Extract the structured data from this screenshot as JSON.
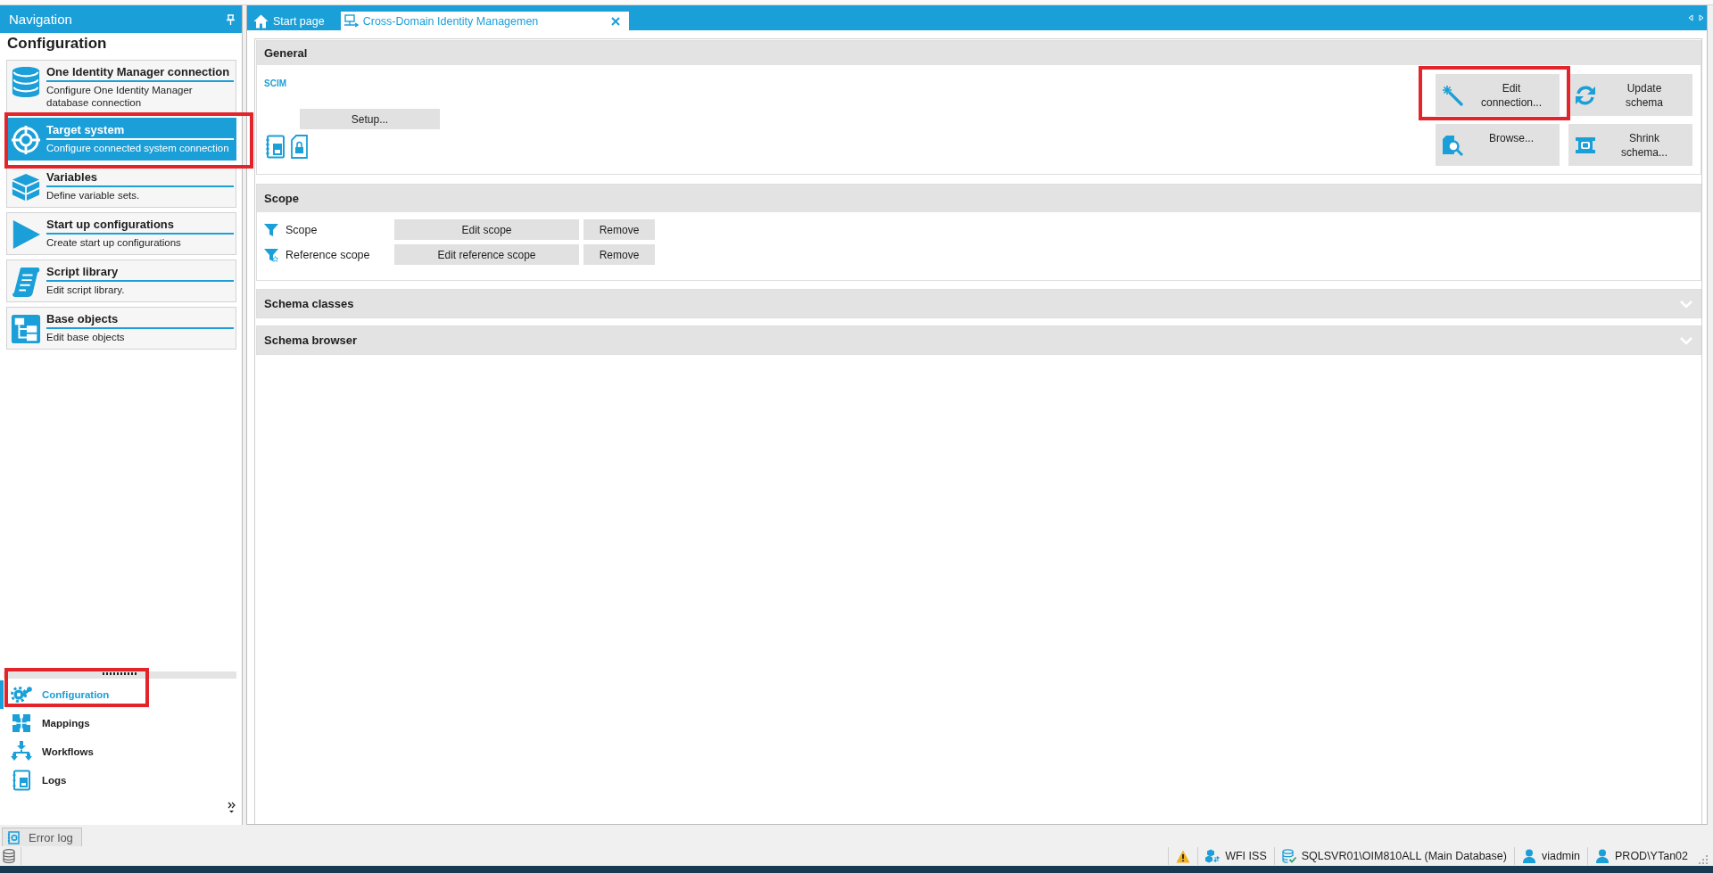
{
  "navigation": {
    "title": "Navigation",
    "heading": "Configuration",
    "items": [
      {
        "title": "One Identity Manager connection",
        "description": "Configure One Identity Manager database connection",
        "selected": false,
        "highlighted": false
      },
      {
        "title": "Target system",
        "description": "Configure connected system connection",
        "selected": true,
        "highlighted": true
      },
      {
        "title": "Variables",
        "description": "Define variable sets.",
        "selected": false,
        "highlighted": false
      },
      {
        "title": "Start up configurations",
        "description": "Create start up configurations",
        "selected": false,
        "highlighted": false
      },
      {
        "title": "Script library",
        "description": "Edit script library.",
        "selected": false,
        "highlighted": false
      },
      {
        "title": "Base objects",
        "description": "Edit base objects",
        "selected": false,
        "highlighted": false
      }
    ],
    "sections": [
      {
        "label": "Configuration",
        "selected": true,
        "highlighted": true
      },
      {
        "label": "Mappings",
        "selected": false,
        "highlighted": false
      },
      {
        "label": "Workflows",
        "selected": false,
        "highlighted": false
      },
      {
        "label": "Logs",
        "selected": false,
        "highlighted": false
      }
    ]
  },
  "tabs": [
    {
      "label": "Start page",
      "selected": false,
      "closable": false
    },
    {
      "label": "Cross-Domain Identity Managemen",
      "selected": true,
      "closable": true
    }
  ],
  "general": {
    "title": "General",
    "logo": "SCIM",
    "setup_button": "Setup...",
    "actions": [
      {
        "label": "Edit connection...",
        "highlighted": true
      },
      {
        "label": "Update schema",
        "highlighted": false
      },
      {
        "label": "Browse...",
        "highlighted": false
      },
      {
        "label": "Shrink schema...",
        "highlighted": false
      }
    ]
  },
  "scope": {
    "title": "Scope",
    "rows": [
      {
        "label": "Scope",
        "edit_button": "Edit scope",
        "remove_button": "Remove"
      },
      {
        "label": "Reference scope",
        "edit_button": "Edit reference scope",
        "remove_button": "Remove"
      }
    ]
  },
  "panels": [
    {
      "title": "Schema classes",
      "expanded": false
    },
    {
      "title": "Schema browser",
      "expanded": false
    }
  ],
  "error_log_tab": {
    "label": "Error log"
  },
  "status_bar": {
    "items": [
      "WFI ISS",
      "SQLSVR01\\OIM810ALL (Main Database)",
      "viadmin",
      "PROD\\YTan02"
    ]
  }
}
